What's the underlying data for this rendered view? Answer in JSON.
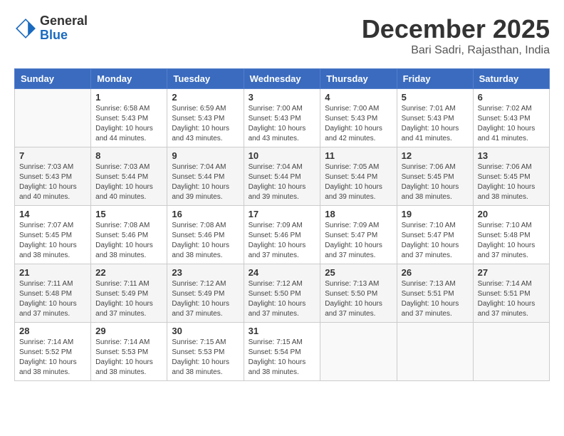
{
  "logo": {
    "general": "General",
    "blue": "Blue"
  },
  "header": {
    "month": "December 2025",
    "location": "Bari Sadri, Rajasthan, India"
  },
  "weekdays": [
    "Sunday",
    "Monday",
    "Tuesday",
    "Wednesday",
    "Thursday",
    "Friday",
    "Saturday"
  ],
  "weeks": [
    [
      {
        "day": "",
        "sunrise": "",
        "sunset": "",
        "daylight": ""
      },
      {
        "day": "1",
        "sunrise": "Sunrise: 6:58 AM",
        "sunset": "Sunset: 5:43 PM",
        "daylight": "Daylight: 10 hours and 44 minutes."
      },
      {
        "day": "2",
        "sunrise": "Sunrise: 6:59 AM",
        "sunset": "Sunset: 5:43 PM",
        "daylight": "Daylight: 10 hours and 43 minutes."
      },
      {
        "day": "3",
        "sunrise": "Sunrise: 7:00 AM",
        "sunset": "Sunset: 5:43 PM",
        "daylight": "Daylight: 10 hours and 43 minutes."
      },
      {
        "day": "4",
        "sunrise": "Sunrise: 7:00 AM",
        "sunset": "Sunset: 5:43 PM",
        "daylight": "Daylight: 10 hours and 42 minutes."
      },
      {
        "day": "5",
        "sunrise": "Sunrise: 7:01 AM",
        "sunset": "Sunset: 5:43 PM",
        "daylight": "Daylight: 10 hours and 41 minutes."
      },
      {
        "day": "6",
        "sunrise": "Sunrise: 7:02 AM",
        "sunset": "Sunset: 5:43 PM",
        "daylight": "Daylight: 10 hours and 41 minutes."
      }
    ],
    [
      {
        "day": "7",
        "sunrise": "Sunrise: 7:03 AM",
        "sunset": "Sunset: 5:43 PM",
        "daylight": "Daylight: 10 hours and 40 minutes."
      },
      {
        "day": "8",
        "sunrise": "Sunrise: 7:03 AM",
        "sunset": "Sunset: 5:44 PM",
        "daylight": "Daylight: 10 hours and 40 minutes."
      },
      {
        "day": "9",
        "sunrise": "Sunrise: 7:04 AM",
        "sunset": "Sunset: 5:44 PM",
        "daylight": "Daylight: 10 hours and 39 minutes."
      },
      {
        "day": "10",
        "sunrise": "Sunrise: 7:04 AM",
        "sunset": "Sunset: 5:44 PM",
        "daylight": "Daylight: 10 hours and 39 minutes."
      },
      {
        "day": "11",
        "sunrise": "Sunrise: 7:05 AM",
        "sunset": "Sunset: 5:44 PM",
        "daylight": "Daylight: 10 hours and 39 minutes."
      },
      {
        "day": "12",
        "sunrise": "Sunrise: 7:06 AM",
        "sunset": "Sunset: 5:45 PM",
        "daylight": "Daylight: 10 hours and 38 minutes."
      },
      {
        "day": "13",
        "sunrise": "Sunrise: 7:06 AM",
        "sunset": "Sunset: 5:45 PM",
        "daylight": "Daylight: 10 hours and 38 minutes."
      }
    ],
    [
      {
        "day": "14",
        "sunrise": "Sunrise: 7:07 AM",
        "sunset": "Sunset: 5:45 PM",
        "daylight": "Daylight: 10 hours and 38 minutes."
      },
      {
        "day": "15",
        "sunrise": "Sunrise: 7:08 AM",
        "sunset": "Sunset: 5:46 PM",
        "daylight": "Daylight: 10 hours and 38 minutes."
      },
      {
        "day": "16",
        "sunrise": "Sunrise: 7:08 AM",
        "sunset": "Sunset: 5:46 PM",
        "daylight": "Daylight: 10 hours and 38 minutes."
      },
      {
        "day": "17",
        "sunrise": "Sunrise: 7:09 AM",
        "sunset": "Sunset: 5:46 PM",
        "daylight": "Daylight: 10 hours and 37 minutes."
      },
      {
        "day": "18",
        "sunrise": "Sunrise: 7:09 AM",
        "sunset": "Sunset: 5:47 PM",
        "daylight": "Daylight: 10 hours and 37 minutes."
      },
      {
        "day": "19",
        "sunrise": "Sunrise: 7:10 AM",
        "sunset": "Sunset: 5:47 PM",
        "daylight": "Daylight: 10 hours and 37 minutes."
      },
      {
        "day": "20",
        "sunrise": "Sunrise: 7:10 AM",
        "sunset": "Sunset: 5:48 PM",
        "daylight": "Daylight: 10 hours and 37 minutes."
      }
    ],
    [
      {
        "day": "21",
        "sunrise": "Sunrise: 7:11 AM",
        "sunset": "Sunset: 5:48 PM",
        "daylight": "Daylight: 10 hours and 37 minutes."
      },
      {
        "day": "22",
        "sunrise": "Sunrise: 7:11 AM",
        "sunset": "Sunset: 5:49 PM",
        "daylight": "Daylight: 10 hours and 37 minutes."
      },
      {
        "day": "23",
        "sunrise": "Sunrise: 7:12 AM",
        "sunset": "Sunset: 5:49 PM",
        "daylight": "Daylight: 10 hours and 37 minutes."
      },
      {
        "day": "24",
        "sunrise": "Sunrise: 7:12 AM",
        "sunset": "Sunset: 5:50 PM",
        "daylight": "Daylight: 10 hours and 37 minutes."
      },
      {
        "day": "25",
        "sunrise": "Sunrise: 7:13 AM",
        "sunset": "Sunset: 5:50 PM",
        "daylight": "Daylight: 10 hours and 37 minutes."
      },
      {
        "day": "26",
        "sunrise": "Sunrise: 7:13 AM",
        "sunset": "Sunset: 5:51 PM",
        "daylight": "Daylight: 10 hours and 37 minutes."
      },
      {
        "day": "27",
        "sunrise": "Sunrise: 7:14 AM",
        "sunset": "Sunset: 5:51 PM",
        "daylight": "Daylight: 10 hours and 37 minutes."
      }
    ],
    [
      {
        "day": "28",
        "sunrise": "Sunrise: 7:14 AM",
        "sunset": "Sunset: 5:52 PM",
        "daylight": "Daylight: 10 hours and 38 minutes."
      },
      {
        "day": "29",
        "sunrise": "Sunrise: 7:14 AM",
        "sunset": "Sunset: 5:53 PM",
        "daylight": "Daylight: 10 hours and 38 minutes."
      },
      {
        "day": "30",
        "sunrise": "Sunrise: 7:15 AM",
        "sunset": "Sunset: 5:53 PM",
        "daylight": "Daylight: 10 hours and 38 minutes."
      },
      {
        "day": "31",
        "sunrise": "Sunrise: 7:15 AM",
        "sunset": "Sunset: 5:54 PM",
        "daylight": "Daylight: 10 hours and 38 minutes."
      },
      {
        "day": "",
        "sunrise": "",
        "sunset": "",
        "daylight": ""
      },
      {
        "day": "",
        "sunrise": "",
        "sunset": "",
        "daylight": ""
      },
      {
        "day": "",
        "sunrise": "",
        "sunset": "",
        "daylight": ""
      }
    ]
  ]
}
